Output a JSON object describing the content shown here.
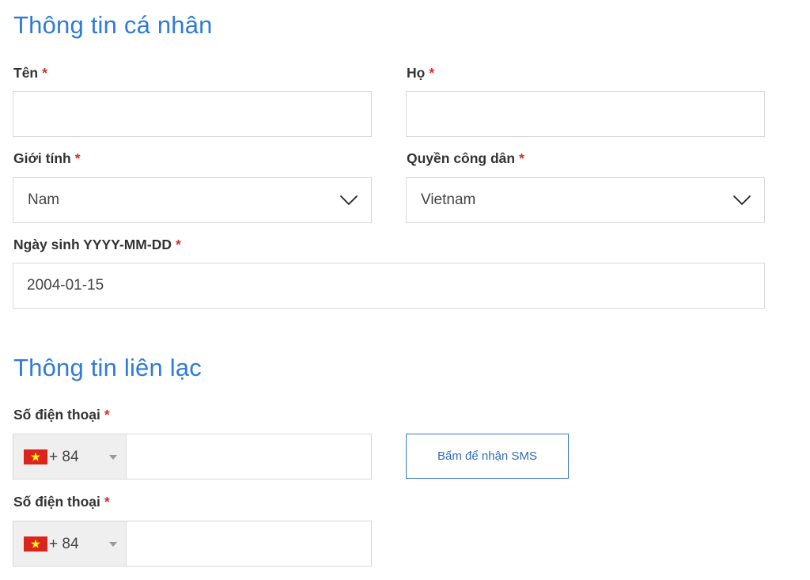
{
  "personal": {
    "title": "Thông tin cá nhân",
    "first_name": {
      "label": "Tên",
      "value": ""
    },
    "last_name": {
      "label": "Họ",
      "value": ""
    },
    "gender": {
      "label": "Giới tính",
      "value": "Nam"
    },
    "citizenship": {
      "label": "Quyền công dân",
      "value": "Vietnam"
    },
    "birthdate": {
      "label": "Ngày sinh YYYY-MM-DD",
      "value": "2004-01-15"
    }
  },
  "contact": {
    "title": "Thông tin liên lạc",
    "phone1": {
      "label": "Số điện thoại",
      "dial_code": "+ 84",
      "value": ""
    },
    "phone2": {
      "label": "Số điện thoại",
      "dial_code": "+ 84",
      "value": ""
    },
    "sms_button": "Bấm để nhận SMS"
  },
  "required_marker": "*",
  "colors": {
    "accent": "#2f7bd9",
    "required": "#d32f2f",
    "field_border": "#d9d9d9",
    "prefix_bg": "#efefef",
    "flag_red": "#da251d",
    "flag_star": "#ffff00"
  },
  "icons": {
    "select_arrow": "chevron-down-icon",
    "country_flag": "vietnam-flag-icon",
    "dropdown_caret": "caret-down-icon"
  }
}
